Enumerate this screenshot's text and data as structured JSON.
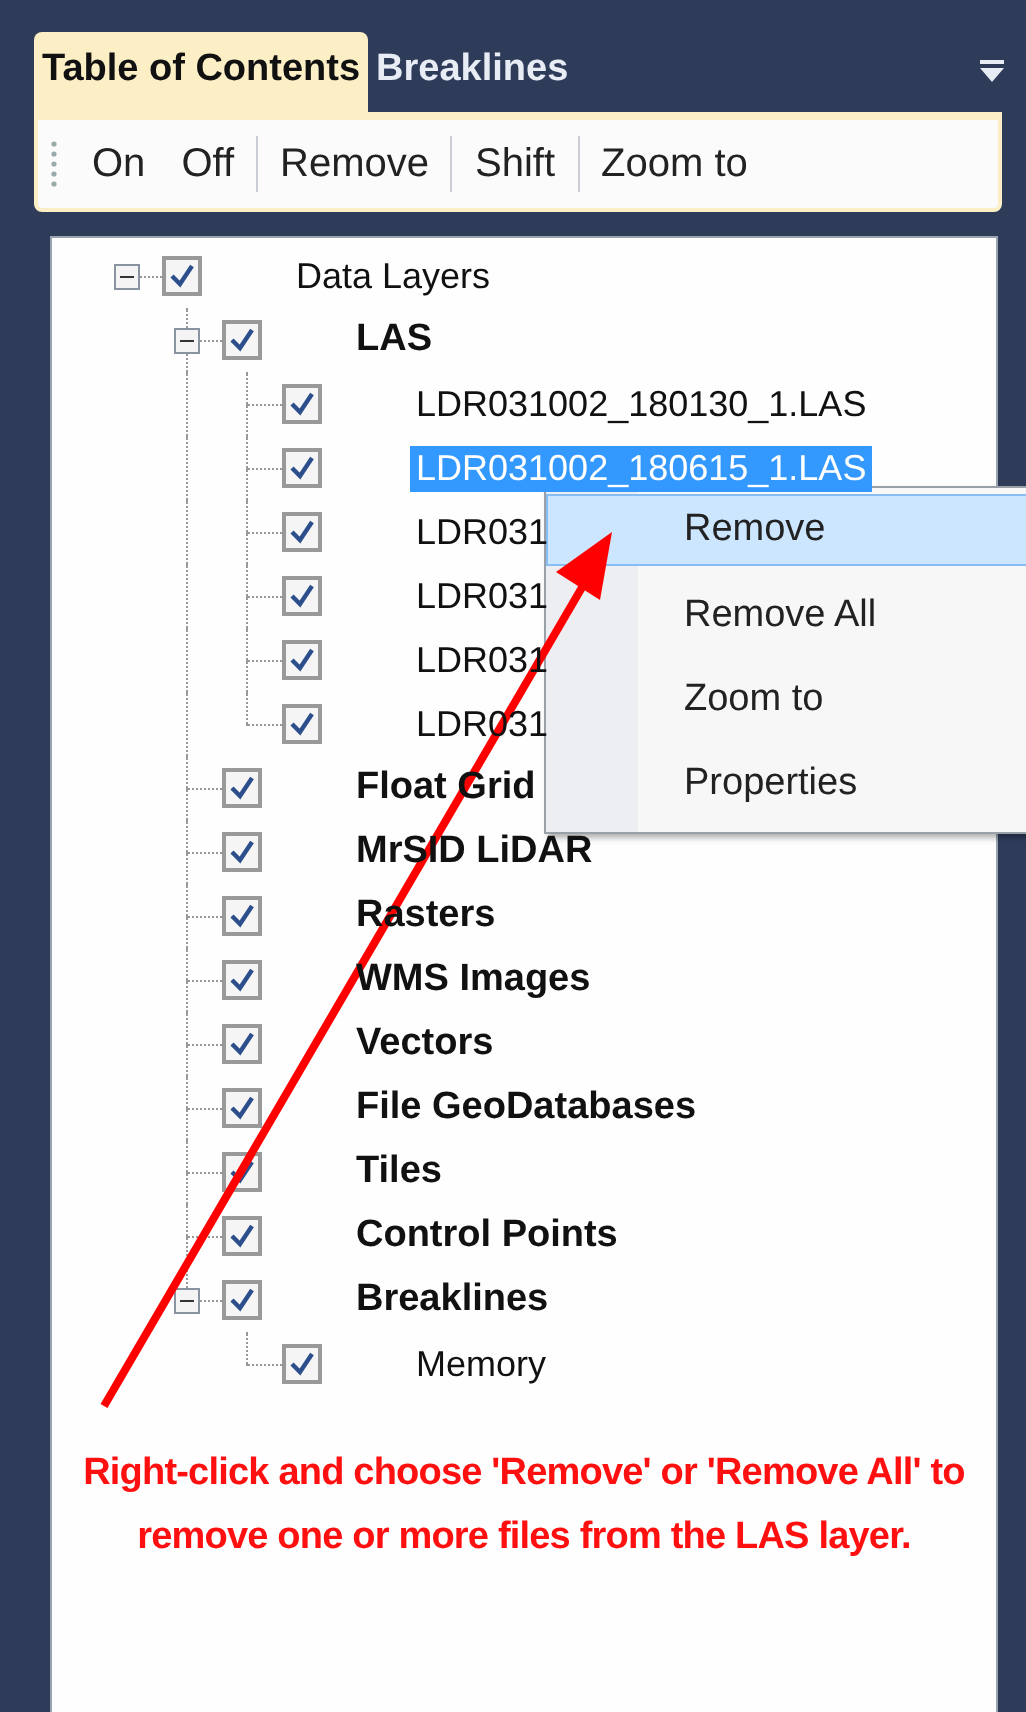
{
  "tabs": [
    {
      "label": "Table of Contents",
      "selected": true
    },
    {
      "label": "Breaklines",
      "selected": false
    }
  ],
  "toolbar": {
    "groups": [
      [
        "On",
        "Off"
      ],
      [
        "Remove"
      ],
      [
        "Shift"
      ],
      [
        "Zoom to"
      ]
    ]
  },
  "tree": [
    {
      "label": "Data Layers",
      "checked": true,
      "expanded": true,
      "selected": false,
      "children": [
        {
          "label": "LAS",
          "checked": true,
          "expanded": true,
          "selected": false,
          "children": [
            {
              "label": "LDR031002_180130_1.LAS",
              "checked": true,
              "selected": false
            },
            {
              "label": "LDR031002_180615_1.LAS",
              "checked": true,
              "selected": true
            },
            {
              "label": "LDR031",
              "checked": true,
              "selected": false
            },
            {
              "label": "LDR031",
              "checked": true,
              "selected": false
            },
            {
              "label": "LDR031",
              "checked": true,
              "selected": false
            },
            {
              "label": "LDR031",
              "checked": true,
              "selected": false
            }
          ]
        },
        {
          "label": "Float Grid",
          "checked": true,
          "selected": false
        },
        {
          "label": "MrSID LiDAR",
          "checked": true,
          "selected": false
        },
        {
          "label": "Rasters",
          "checked": true,
          "selected": false
        },
        {
          "label": "WMS Images",
          "checked": true,
          "selected": false
        },
        {
          "label": "Vectors",
          "checked": true,
          "selected": false
        },
        {
          "label": "File GeoDatabases",
          "checked": true,
          "selected": false
        },
        {
          "label": "Tiles",
          "checked": true,
          "selected": false
        },
        {
          "label": "Control Points",
          "checked": true,
          "selected": false
        },
        {
          "label": "Breaklines",
          "checked": true,
          "expanded": true,
          "selected": false,
          "children": [
            {
              "label": "Memory",
              "checked": true,
              "selected": false
            }
          ]
        }
      ]
    }
  ],
  "context_menu": {
    "items": [
      {
        "label": "Remove",
        "selected": true
      },
      {
        "label": "Remove All",
        "selected": false
      },
      {
        "label": "Zoom to",
        "selected": false
      },
      {
        "label": "Properties",
        "selected": false
      }
    ]
  },
  "annotation": {
    "text": "Right-click and choose 'Remove' or 'Remove All' to remove one or more files from the LAS layer."
  }
}
